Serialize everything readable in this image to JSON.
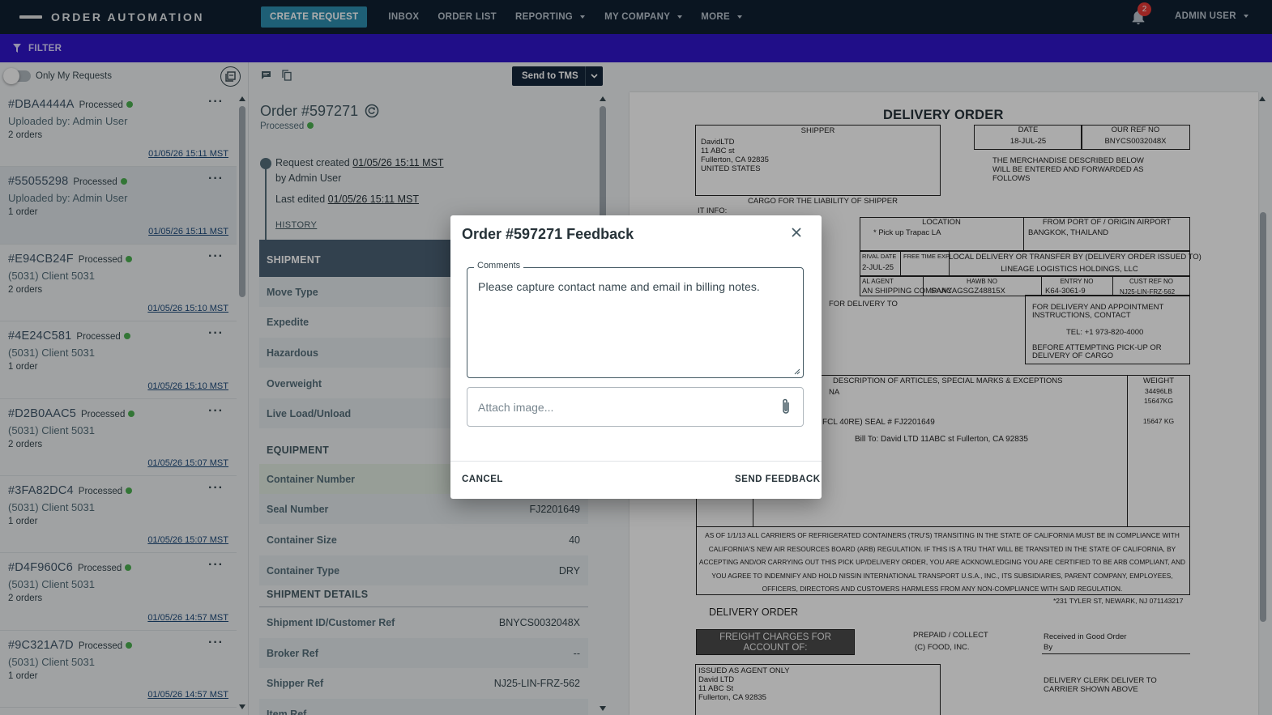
{
  "app": {
    "brand": "ORDER AUTOMATION",
    "nav": {
      "create_request": "CREATE REQUEST",
      "inbox": "INBOX",
      "order_list": "ORDER LIST",
      "reporting": "REPORTING",
      "my_company": "MY COMPANY",
      "more": "MORE"
    },
    "notifications_count": "2",
    "user": "ADMIN USER"
  },
  "filter": {
    "label": "FILTER"
  },
  "list": {
    "only_my_requests": "Only My Requests",
    "items": [
      {
        "id": "#DBA4444A",
        "status": "Processed",
        "line2": "Uploaded by: Admin User",
        "line3": "2 orders",
        "date": "01/05/26 15:11 MST"
      },
      {
        "id": "#55055298",
        "status": "Processed",
        "line2": "Uploaded by: Admin User",
        "line3": "1 order",
        "date": "01/05/26 15:11 MST"
      },
      {
        "id": "#E94CB24F",
        "status": "Processed",
        "line2": "(5031) Client 5031",
        "line3": "2 orders",
        "date": "01/05/26 15:10 MST"
      },
      {
        "id": "#4E24C581",
        "status": "Processed",
        "line2": "(5031) Client 5031",
        "line3": "1 order",
        "date": "01/05/26 15:10 MST"
      },
      {
        "id": "#D2B0AAC5",
        "status": "Processed",
        "line2": "(5031) Client 5031",
        "line3": "2 orders",
        "date": "01/05/26 15:07 MST"
      },
      {
        "id": "#3FA82DC4",
        "status": "Processed",
        "line2": "(5031) Client 5031",
        "line3": "1 order",
        "date": "01/05/26 15:07 MST"
      },
      {
        "id": "#D4F960C6",
        "status": "Processed",
        "line2": "(5031) Client 5031",
        "line3": "2 orders",
        "date": "01/05/26 14:57 MST"
      },
      {
        "id": "#9C321A7D",
        "status": "Processed",
        "line2": "(5031) Client 5031",
        "line3": "1 order",
        "date": "01/05/26 14:57 MST"
      }
    ]
  },
  "detail": {
    "send_to_tms": "Send to TMS",
    "order_title": "Order #597271",
    "status": "Processed",
    "request_created_label": "Request created",
    "request_created_date": "01/05/26 15:11 MST",
    "created_by": "by Admin User",
    "last_edited_label": "Last edited",
    "last_edited_date": "01/05/26 15:11 MST",
    "history": "HISTORY",
    "shipment_header": "SHIPMENT",
    "shipment_rows": [
      "Move Type",
      "Expedite",
      "Hazardous",
      "Overweight",
      "Live Load/Unload"
    ],
    "equipment_header": "EQUIPMENT",
    "container_number_label": "Container Number",
    "seal_number": {
      "label": "Seal Number",
      "value": "FJ2201649"
    },
    "container_size": {
      "label": "Container Size",
      "value": "40"
    },
    "container_type": {
      "label": "Container Type",
      "value": "DRY"
    },
    "shipment_details_header": "SHIPMENT DETAILS",
    "shipment_id": {
      "label": "Shipment ID/Customer Ref",
      "value": "BNYCS0032048X"
    },
    "broker_ref": {
      "label": "Broker Ref",
      "value": "--"
    },
    "shipper_ref": {
      "label": "Shipper Ref",
      "value": "NJ25-LIN-FRZ-562"
    },
    "item_ref_label": "Item Ref"
  },
  "document": {
    "title": "DELIVERY ORDER",
    "shipper_label": "SHIPPER",
    "shipper_lines": [
      "DavidLTD",
      "11 ABC st",
      "Fullerton, CA 92835",
      "UNITED STATES"
    ],
    "date_label": "DATE",
    "date_value": "18-JUL-25",
    "our_ref_label": "OUR REF NO",
    "our_ref_value": "BNYCS0032048X",
    "merchandise_text": [
      "THE MERCHANDISE DESCRIBED BELOW",
      "WILL BE ENTERED AND FORWARDED AS",
      "FOLLOWS"
    ],
    "cargo_text": "CARGO FOR THE LIABILITY OF SHIPPER",
    "it_info": "IT INFO:",
    "location_label": "LOCATION",
    "location_value": "* Pick up  Trapac LA",
    "from_port_label": "FROM PORT OF / ORIGIN AIRPORT",
    "from_port_value": "BANGKOK, THAILAND",
    "arrival_date_label": "RIVAL DATE",
    "arrival_date_value": "2-JUL-25",
    "free_time_label": "FREE TIME EXP",
    "local_delivery_label": "LOCAL DELIVERY OR TRANSFER BY (DELIVERY ORDER ISSUED TO)",
    "local_delivery_value": "LINEAGE LOGISTICS HOLDINGS, LLC",
    "agent_label": "AL AGENT",
    "agent_value": "AN SHIPPING COMPANY",
    "hawb_label": "HAWB NO",
    "hawb_value": "SAACAGSGZ48815X",
    "entry_label": "ENTRY NO",
    "entry_value": "K64-3061-9",
    "cust_ref_label": "CUST REF NO",
    "cust_ref_value": "NJ25-LIN-FRZ-562",
    "for_delivery_to": "FOR DELIVERY TO",
    "contact_lines": [
      "FOR DELIVERY AND APPOINTMENT",
      "INSTRUCTIONS, CONTACT"
    ],
    "tel": "TEL: +1 973-820-4000",
    "before_lines": [
      "BEFORE ATTEMPTING PICK-UP OR",
      "DELIVERY OF CARGO"
    ],
    "description_label": "DESCRIPTION OF ARTICLES, SPECIAL MARKS & EXCEPTIONS",
    "weight_label": "WEIGHT",
    "desc_na": "NA",
    "seal_line": "FCL 40RE) SEAL # FJ2201649",
    "bill_to": "Bill To: David LTD 11ABC st Fullerton, CA 92835",
    "weights": [
      "34496LB",
      "15647KG",
      "15647 KG"
    ],
    "legal_lines": [
      "AS OF 1/1/13 ALL CARRIERS OF REFRIGERATED CONTAINERS (TRU'S) TRANSITING IN THE STATE OF CALIFORNIA MUST BE IN COMPLIANCE WITH",
      "CALIFORNIA'S NEW AIR RESOURCES BOARD (ARB) REGULATION.  IF THIS IS A TRU THAT WILL BE TRANSITED IN THE STATE OF CALIFORNIA, BY",
      "ACCEPTING AND/OR CARRYING OUT THIS PICK UP/DELIVERY ORDER, YOU ARE ACKNOWLEDGING YOU ARE CERTIFIED TO BE ARB COMPLIANT, AND",
      "YOU AGREE TO INDEMNIFY AND HOLD NISSIN INTERNATIONAL TRANSPORT U.S.A., INC., ITS SUBSIDIARIES, PARENT COMPANY, EMPLOYEES,",
      "OFFICERS, DIRECTORS AND CUSTOMERS HARMLESS FROM ANY NON-COMPLIANCE WITH SAID REGULATION."
    ],
    "address_footer": "*231 TYLER ST, NEWARK, NJ 071143217",
    "delivery_order_footer": "DELIVERY ORDER",
    "freight_charges": [
      "FREIGHT CHARGES FOR",
      "ACCOUNT OF:"
    ],
    "prepaid_collect": "PREPAID / COLLECT",
    "food_inc": "(C)  FOOD, INC.",
    "received": "Received in Good Order",
    "by": "By",
    "issued_lines": [
      "ISSUED AS AGENT ONLY",
      "David LTD",
      "11 ABC St",
      "Fullerton, CA 92835"
    ],
    "delivery_clerk": [
      "DELIVERY CLERK DELIVER TO",
      "CARRIER SHOWN ABOVE"
    ]
  },
  "modal": {
    "title": "Order #597271 Feedback",
    "comments_label": "Comments",
    "comments_value": "Please capture contact name and email in billing notes.",
    "attach_placeholder": "Attach image...",
    "cancel": "CANCEL",
    "send": "SEND FEEDBACK"
  },
  "colors": {
    "nav_bg": "#0f1f31",
    "filter_bg": "#3015c9",
    "accent": "#2d8cae",
    "status_green": "#4caf50",
    "section_header": "#4b6073"
  }
}
